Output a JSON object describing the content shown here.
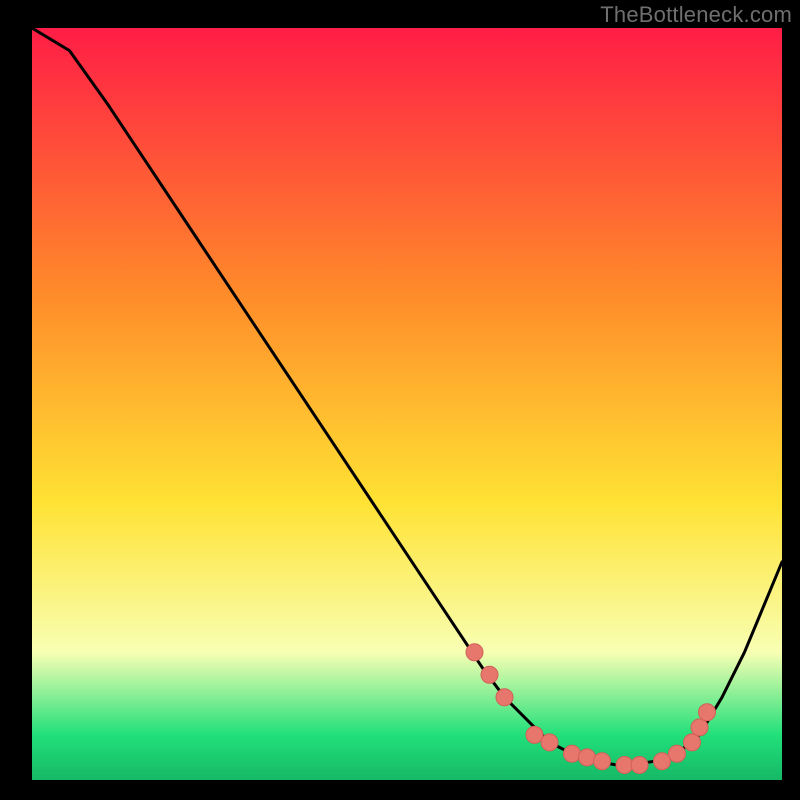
{
  "watermark": "TheBottleneck.com",
  "colors": {
    "bg": "#000000",
    "stroke": "#000000",
    "dot_fill": "#e7766d",
    "dot_stroke": "#d06058",
    "gradient_top": "#ff1d46",
    "gradient_mid1": "#ff8a2a",
    "gradient_mid2": "#ffe233",
    "gradient_pale": "#f8ffb3",
    "gradient_green": "#21e07a",
    "gradient_bottom": "#16b866"
  },
  "chart_data": {
    "type": "line",
    "title": "",
    "xlabel": "",
    "ylabel": "",
    "xlim": [
      0,
      100
    ],
    "ylim": [
      0,
      100
    ],
    "series": [
      {
        "name": "curve",
        "x": [
          0,
          5,
          10,
          15,
          20,
          25,
          30,
          35,
          40,
          45,
          50,
          55,
          60,
          63,
          66,
          69,
          72,
          75,
          78,
          80,
          83,
          86,
          89,
          92,
          95,
          100
        ],
        "y": [
          100,
          97,
          90,
          82.5,
          75,
          67.5,
          60,
          52.5,
          45,
          37.5,
          30,
          22.5,
          15,
          11,
          8,
          5,
          3.5,
          2.5,
          2,
          2,
          2.5,
          3.5,
          6,
          11,
          17,
          29
        ]
      }
    ],
    "dots": {
      "name": "highlighted-points",
      "x": [
        59,
        61,
        63,
        67,
        69,
        72,
        74,
        76,
        79,
        81,
        84,
        86,
        88,
        89,
        90
      ],
      "y": [
        17,
        14,
        11,
        6,
        5,
        3.5,
        3,
        2.5,
        2,
        2,
        2.5,
        3.5,
        5,
        7,
        9
      ]
    }
  }
}
